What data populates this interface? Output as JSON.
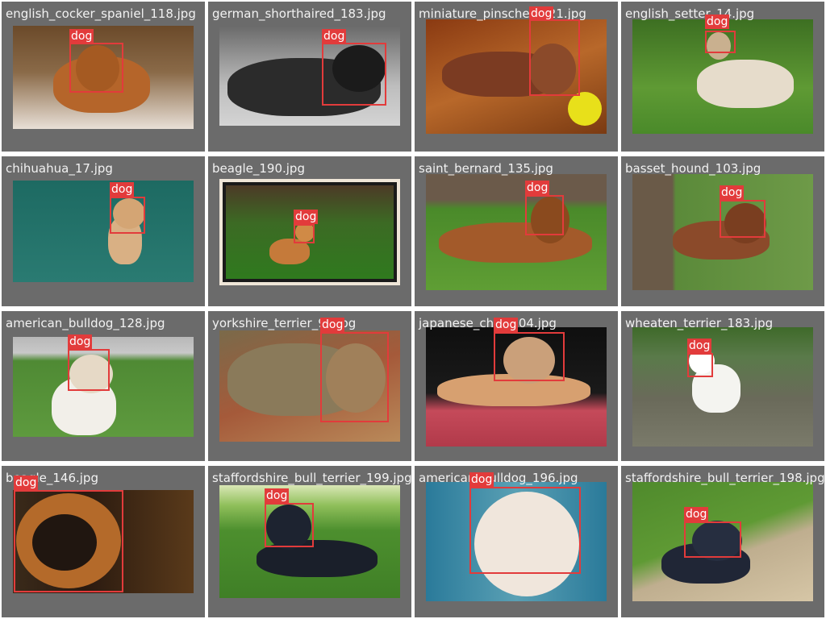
{
  "detections": [
    {
      "file": "english_cocker_spaniel_118.jpg",
      "label": "dog",
      "bg": "#c8a884",
      "bg2": "#e8dfd6",
      "fg": "#b5652a"
    },
    {
      "file": "german_shorthaired_183.jpg",
      "label": "dog",
      "bg": "#9a9a9a",
      "bg2": "#c4c4c4",
      "fg": "#2b2b2b"
    },
    {
      "file": "miniature_pinscher_121.jpg",
      "label": "dog",
      "bg": "#a1521d",
      "bg2": "#7a3a12",
      "fg": "#7b3b22"
    },
    {
      "file": "english_setter_14.jpg",
      "label": "dog",
      "bg": "#4e8a2a",
      "bg2": "#6ea43b",
      "fg": "#e6dccb"
    },
    {
      "file": "chihuahua_17.jpg",
      "label": "dog",
      "bg": "#1d6a62",
      "bg2": "#2a7b72",
      "fg": "#d9b084"
    },
    {
      "file": "beagle_190.jpg",
      "label": "dog",
      "bg": "#2f7a1e",
      "bg2": "#4c3a26",
      "fg": "#c57a3a"
    },
    {
      "file": "saint_bernard_135.jpg",
      "label": "dog",
      "bg": "#4a8a2a",
      "bg2": "#6b5a4a",
      "fg": "#a35a2a"
    },
    {
      "file": "basset_hound_103.jpg",
      "label": "dog",
      "bg": "#5b8a3a",
      "bg2": "#6a5a48",
      "fg": "#8b4a2a"
    },
    {
      "file": "american_bulldog_128.jpg",
      "label": "dog",
      "bg": "#4f8a34",
      "bg2": "#b8b8b8",
      "fg": "#f2efe9"
    },
    {
      "file": "yorkshire_terrier_93.jpg",
      "label": "dog",
      "bg": "#a55a3a",
      "bg2": "#b98a5a",
      "fg": "#8a7a5a"
    },
    {
      "file": "japanese_chin_104.jpg",
      "label": "dog",
      "bg": "#1a1a1a",
      "bg2": "#c54a5a",
      "fg": "#d7a070"
    },
    {
      "file": "wheaten_terrier_183.jpg",
      "label": "dog",
      "bg": "#6a6a5a",
      "bg2": "#3f6a2a",
      "fg": "#f4f4f0"
    },
    {
      "file": "beagle_146.jpg",
      "label": "dog",
      "bg": "#2a1a10",
      "bg2": "#5a3a1a",
      "fg": "#b46a2a"
    },
    {
      "file": "staffordshire_bull_terrier_199.jpg",
      "label": "dog",
      "bg": "#4d8f2e",
      "bg2": "#d9e7b5",
      "fg": "#1a1f2a"
    },
    {
      "file": "american_bulldog_196.jpg",
      "label": "dog",
      "bg": "#2a7a9a",
      "bg2": "#d6c6b6",
      "fg": "#f0e6dc"
    },
    {
      "file": "staffordshire_bull_terrier_198.jpg",
      "label": "dog",
      "bg": "#4f8a2c",
      "bg2": "#bfae8f",
      "fg": "#202636"
    }
  ]
}
